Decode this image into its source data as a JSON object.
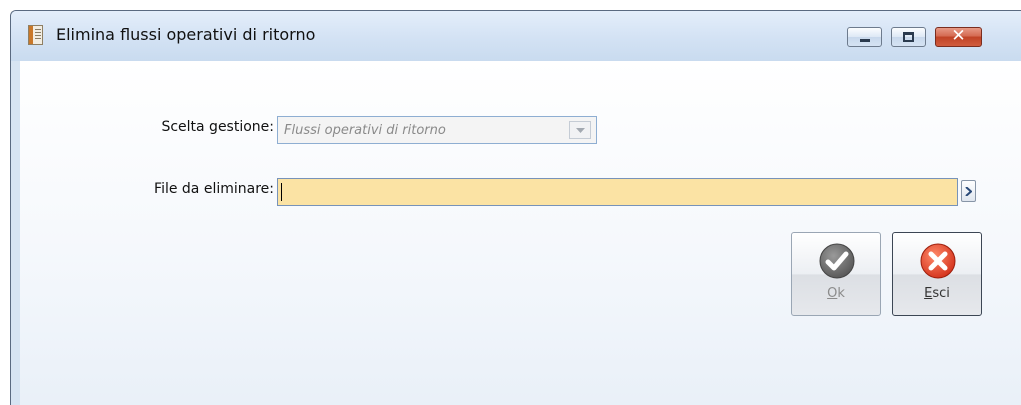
{
  "window": {
    "title": "Elimina flussi operativi di ritorno",
    "controls": [
      "minimize",
      "maximize",
      "close"
    ],
    "close_glyph": "✕"
  },
  "form": {
    "gestione": {
      "label": "Scelta gestione:",
      "value": "Flussi operativi di ritorno",
      "enabled": false
    },
    "file": {
      "label": "File da eliminare:",
      "value": "",
      "highlight_color": "#fbe3a4"
    }
  },
  "buttons": {
    "ok": {
      "label_accel": "O",
      "label_rest": "k",
      "enabled": false,
      "icon": "checkmark-icon"
    },
    "esci": {
      "label_accel": "E",
      "label_rest": "sci",
      "enabled": true,
      "icon": "cancel-x-icon"
    }
  },
  "colors": {
    "ok_icon": "#6f6f6f",
    "esci_icon": "#e0402a",
    "field_border": "#7793b9"
  }
}
